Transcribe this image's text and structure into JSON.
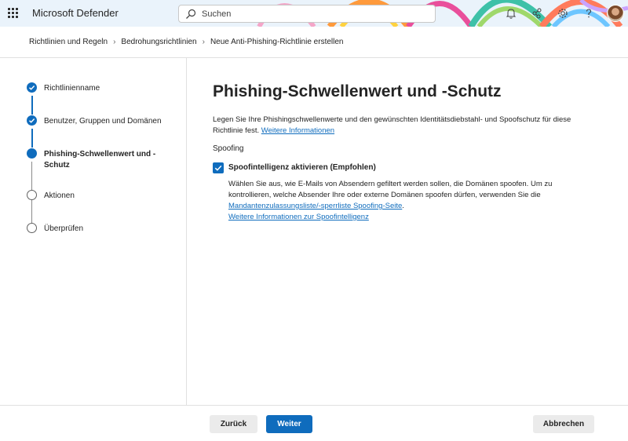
{
  "app": {
    "title": "Microsoft Defender"
  },
  "search": {
    "placeholder": "Suchen"
  },
  "header_icons": [
    "bell-icon",
    "share-icon",
    "gear-icon",
    "help-icon"
  ],
  "breadcrumb": [
    "Richtlinien und Regeln",
    "Bedrohungsrichtlinien",
    "Neue Anti-Phishing-Richtlinie erstellen"
  ],
  "steps": [
    {
      "label": "Richtlinienname",
      "state": "done"
    },
    {
      "label": "Benutzer, Gruppen und Domänen",
      "state": "done"
    },
    {
      "label": "Phishing-Schwellenwert und -Schutz",
      "state": "current"
    },
    {
      "label": "Aktionen",
      "state": "todo"
    },
    {
      "label": "Überprüfen",
      "state": "todo"
    }
  ],
  "main": {
    "title": "Phishing-Schwellenwert und -Schutz",
    "description": "Legen Sie Ihre Phishingschwellenwerte und den gewünschten Identitätsdiebstahl- und Spoofschutz für diese Richtlinie fest.",
    "description_link": "Weitere Informationen",
    "section_title": "Spoofing",
    "spoof_checkbox": {
      "label": "Spoofintelligenz aktivieren (Empfohlen)",
      "checked": true
    },
    "spoof_description": "Wählen Sie aus, wie E-Mails von Absendern gefiltert werden sollen, die Domänen spoofen. Um zu kontrollieren, welche Absender Ihre oder externe Domänen spoofen dürfen, verwenden Sie die",
    "spoof_link_1": "Mandantenzulassungsliste/-sperrliste Spoofing-Seite",
    "spoof_link_1_suffix": ".",
    "spoof_link_2": "Weitere Informationen zur Spoofintelligenz"
  },
  "footer": {
    "back_label": "Zurück",
    "next_label": "Weiter",
    "cancel_label": "Abbrechen"
  },
  "colors": {
    "accent": "#0f6cbd",
    "header_bg": "#eaf3fb"
  }
}
